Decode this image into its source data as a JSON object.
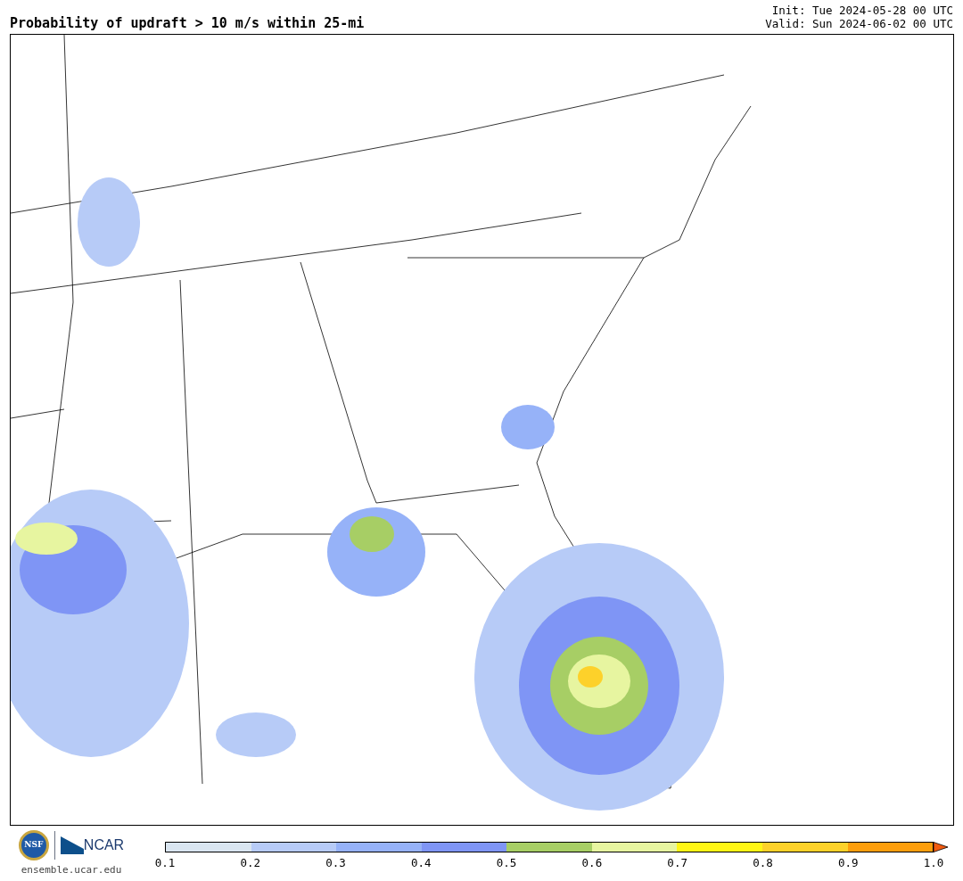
{
  "title": "Probability of updraft > 10 m/s within 25-mi",
  "init": "Init: Tue 2024-05-28 00 UTC",
  "valid": "Valid: Sun 2024-06-02 00 UTC",
  "logos": {
    "nsf": "NSF",
    "ncar": "NCAR",
    "site": "ensemble.ucar.edu"
  },
  "legend": {
    "bins": [
      {
        "kind": "bin",
        "color": "#d9e5f0"
      },
      {
        "kind": "bin",
        "color": "#b7cbf7"
      },
      {
        "kind": "bin",
        "color": "#96b2f8"
      },
      {
        "kind": "bin",
        "color": "#7f95f5"
      },
      {
        "kind": "bin",
        "color": "#a7ce65"
      },
      {
        "kind": "bin",
        "color": "#e7f5a0"
      },
      {
        "kind": "bin",
        "color": "#fff615"
      },
      {
        "kind": "bin",
        "color": "#fdd12a"
      },
      {
        "kind": "bin",
        "color": "#fd9e0c"
      },
      {
        "kind": "arrow",
        "color": "#f15a0f"
      }
    ],
    "ticks": [
      "0.1",
      "0.2",
      "0.3",
      "0.4",
      "0.5",
      "0.6",
      "0.7",
      "0.8",
      "0.9",
      "1.0"
    ]
  }
}
